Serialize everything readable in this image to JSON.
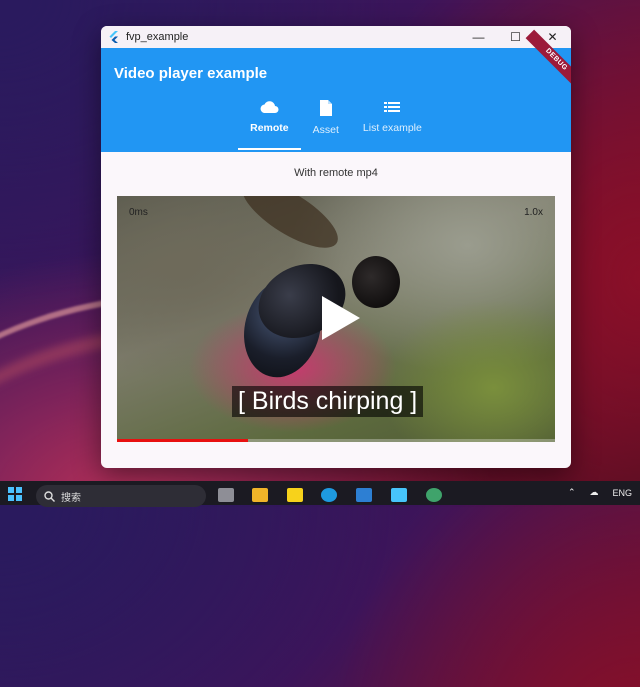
{
  "window": {
    "title": "fvp_example",
    "minimize_icon": "—",
    "maximize_icon": "☐",
    "close_icon": "✕"
  },
  "appbar": {
    "heading": "Video player example",
    "debug_banner": "DEBUG",
    "tabs": [
      {
        "label": "Remote",
        "icon": "cloud-icon",
        "active": true
      },
      {
        "label": "Asset",
        "icon": "file-icon",
        "active": false
      },
      {
        "label": "List example",
        "icon": "list-icon",
        "active": false
      }
    ]
  },
  "content": {
    "subtitle": "With remote mp4",
    "player": {
      "position": "0ms",
      "speed": "1.0x",
      "caption": "[ Birds chirping ]",
      "progress_fraction": 0.3
    }
  },
  "taskbar": {
    "search_placeholder": "搜索",
    "language": "ENG"
  },
  "colors": {
    "primary": "#2196f3",
    "progress": "#e81010",
    "debug_banner": "#9c1a3a"
  }
}
